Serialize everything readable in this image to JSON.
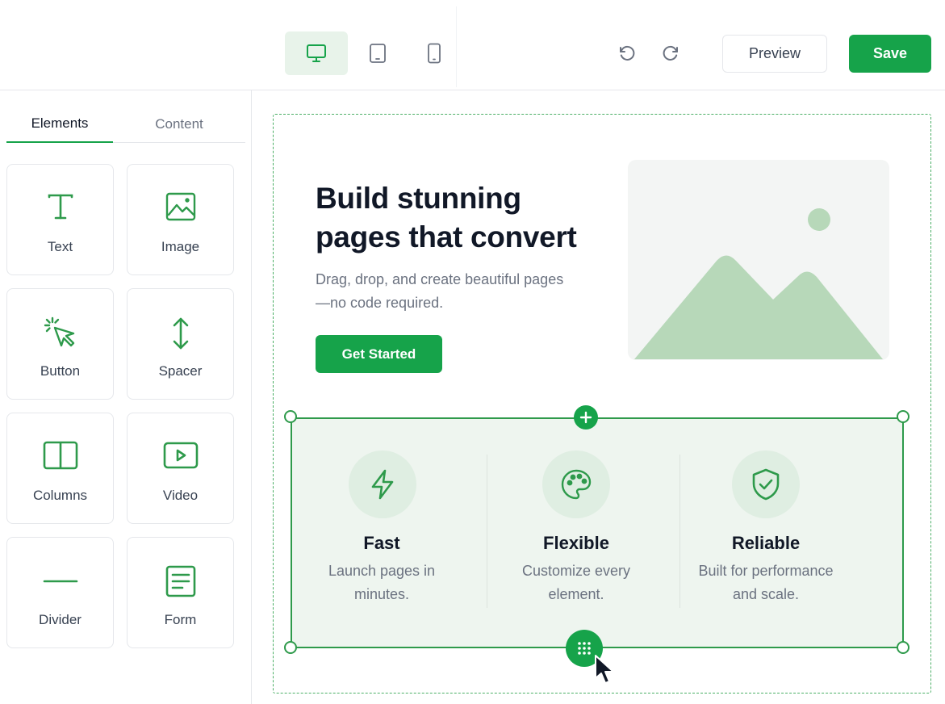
{
  "colors": {
    "accent": "#16a34a",
    "accent_light": "#e8f3ea",
    "selection": "#2e9a4b",
    "image_green": "#b7d8b9"
  },
  "toolbar": {
    "devices": [
      {
        "name": "desktop",
        "icon": "monitor-icon",
        "active": true
      },
      {
        "name": "tablet",
        "icon": "tablet-icon",
        "active": false
      },
      {
        "name": "mobile",
        "icon": "smartphone-icon",
        "active": false
      }
    ],
    "undo_icon": "undo-icon",
    "redo_icon": "redo-icon",
    "preview_label": "Preview",
    "save_label": "Save"
  },
  "sidebar": {
    "tabs": [
      {
        "label": "Elements",
        "active": true
      },
      {
        "label": "Content",
        "active": false
      }
    ],
    "elements": [
      {
        "label": "Text",
        "icon": "text-icon"
      },
      {
        "label": "Image",
        "icon": "image-icon"
      },
      {
        "label": "Button",
        "icon": "pointer-click-icon"
      },
      {
        "label": "Spacer",
        "icon": "vertical-arrows-icon"
      },
      {
        "label": "Columns",
        "icon": "columns-icon"
      },
      {
        "label": "Video",
        "icon": "video-icon"
      },
      {
        "label": "Divider",
        "icon": "divider-icon"
      },
      {
        "label": "Form",
        "icon": "form-icon"
      }
    ]
  },
  "canvas": {
    "hero": {
      "title": "Build stunning pages that convert",
      "subtitle": "Drag, drop, and create beautiful pages—no code required.",
      "cta_label": "Get Started",
      "image_icon": "landscape-placeholder-icon"
    },
    "features": [
      {
        "title": "Fast",
        "desc": "Launch pages in minutes.",
        "icon": "lightning-icon"
      },
      {
        "title": "Flexible",
        "desc": "Customize every element.",
        "icon": "palette-icon"
      },
      {
        "title": "Reliable",
        "desc": "Built for performance and scale.",
        "icon": "shield-check-icon"
      }
    ],
    "add_icon": "plus-icon",
    "drag_icon": "grip-dots-icon",
    "cursor_icon": "mouse-cursor-icon"
  }
}
